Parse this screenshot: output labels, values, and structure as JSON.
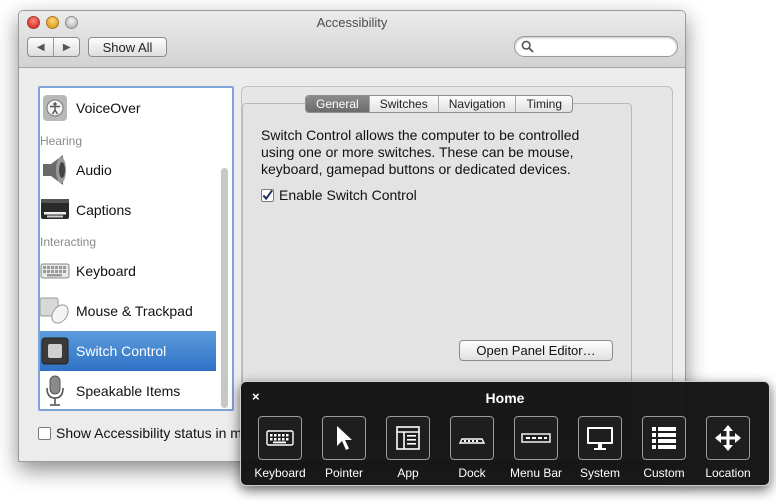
{
  "window": {
    "title": "Accessibility"
  },
  "toolbar": {
    "back_label": "◀",
    "forward_label": "▶",
    "show_all_label": "Show All",
    "search_placeholder": ""
  },
  "sidebar": {
    "items": [
      {
        "label": "VoiceOver",
        "icon": "voiceover-icon"
      },
      {
        "label": "Audio",
        "icon": "speaker-icon"
      },
      {
        "label": "Captions",
        "icon": "captions-icon"
      },
      {
        "label": "Keyboard",
        "icon": "keyboard-icon"
      },
      {
        "label": "Mouse & Trackpad",
        "icon": "mouse-icon"
      },
      {
        "label": "Switch Control",
        "icon": "switch-control-icon",
        "selected": true
      },
      {
        "label": "Speakable Items",
        "icon": "microphone-icon"
      }
    ],
    "headers": {
      "hearing": "Hearing",
      "interacting": "Interacting"
    }
  },
  "status_checkbox": {
    "label": "Show Accessibility status in m",
    "checked": false
  },
  "tabs": [
    {
      "label": "General",
      "active": true
    },
    {
      "label": "Switches"
    },
    {
      "label": "Navigation"
    },
    {
      "label": "Timing"
    }
  ],
  "general": {
    "description": "Switch Control allows the computer to be controlled using one or more switches. These can be mouse, keyboard, gamepad buttons or dedicated devices.",
    "enable_label": "Enable Switch Control",
    "enable_checked": true,
    "open_panel_editor_label": "Open Panel Editor…"
  },
  "switch_panel": {
    "close_label": "×",
    "title": "Home",
    "buttons": [
      {
        "label": "Keyboard",
        "icon": "keyboard-icon"
      },
      {
        "label": "Pointer",
        "icon": "pointer-icon"
      },
      {
        "label": "App",
        "icon": "app-icon"
      },
      {
        "label": "Dock",
        "icon": "dock-icon"
      },
      {
        "label": "Menu Bar",
        "icon": "menu-bar-icon"
      },
      {
        "label": "System",
        "icon": "display-icon"
      },
      {
        "label": "Custom",
        "icon": "list-icon"
      },
      {
        "label": "Location",
        "icon": "move-arrows-icon"
      }
    ]
  },
  "colors": {
    "selection": "#3f82d0",
    "panel_bg": "#121212"
  }
}
